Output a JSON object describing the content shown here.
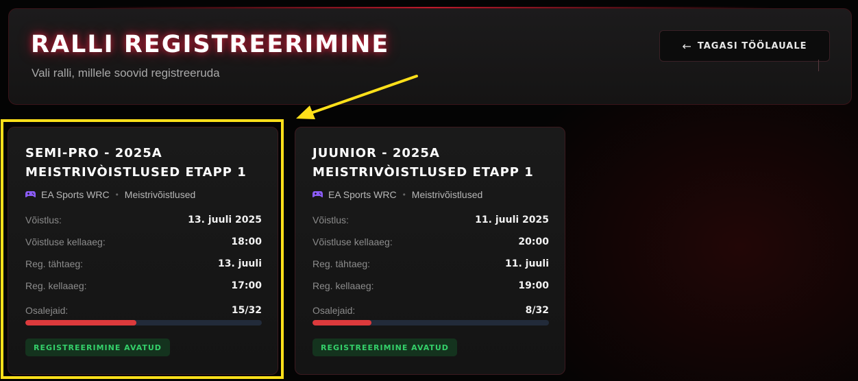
{
  "header": {
    "title": "RALLI REGISTREERIMINE",
    "subtitle": "Vali ralli, millele soovid registreeruda",
    "back_button": {
      "arrow": "←",
      "label": "TAGASI TÖÖLAUALE"
    }
  },
  "cards": [
    {
      "title": "SEMI-PRO - 2025A MEISTRIVÒISTLUSED ETAPP 1",
      "game": "EA Sports WRC",
      "game_icon": "gamepad-icon",
      "separator": "•",
      "category": "Meistrivõistlused",
      "rows": [
        {
          "label": "Võistlus:",
          "value": "13. juuli 2025"
        },
        {
          "label": "Võistluse kellaaeg:",
          "value": "18:00"
        },
        {
          "label": "Reg. tähtaeg:",
          "value": "13. juuli"
        },
        {
          "label": "Reg. kellaaeg:",
          "value": "17:00"
        }
      ],
      "participants": {
        "label": "Osalejaid:",
        "value": "15/32",
        "current": 15,
        "max": 32
      },
      "status": "REGISTREERIMINE AVATUD"
    },
    {
      "title": "JUUNIOR - 2025A MEISTRIVÒISTLUSED ETAPP 1",
      "game": "EA Sports WRC",
      "game_icon": "gamepad-icon",
      "separator": "•",
      "category": "Meistrivõistlused",
      "rows": [
        {
          "label": "Võistlus:",
          "value": "11. juuli 2025"
        },
        {
          "label": "Võistluse kellaaeg:",
          "value": "20:00"
        },
        {
          "label": "Reg. tähtaeg:",
          "value": "11. juuli"
        },
        {
          "label": "Reg. kellaaeg:",
          "value": "19:00"
        }
      ],
      "participants": {
        "label": "Osalejaid:",
        "value": "8/32",
        "current": 8,
        "max": 32
      },
      "status": "REGISTREERIMINE AVATUD"
    }
  ],
  "colors": {
    "accent": "#dc3a3c",
    "progress_track": "#222b3a",
    "status_badge_bg": "#14331e",
    "status_badge_text": "#34d06a",
    "annotation": "#ffe01a"
  }
}
